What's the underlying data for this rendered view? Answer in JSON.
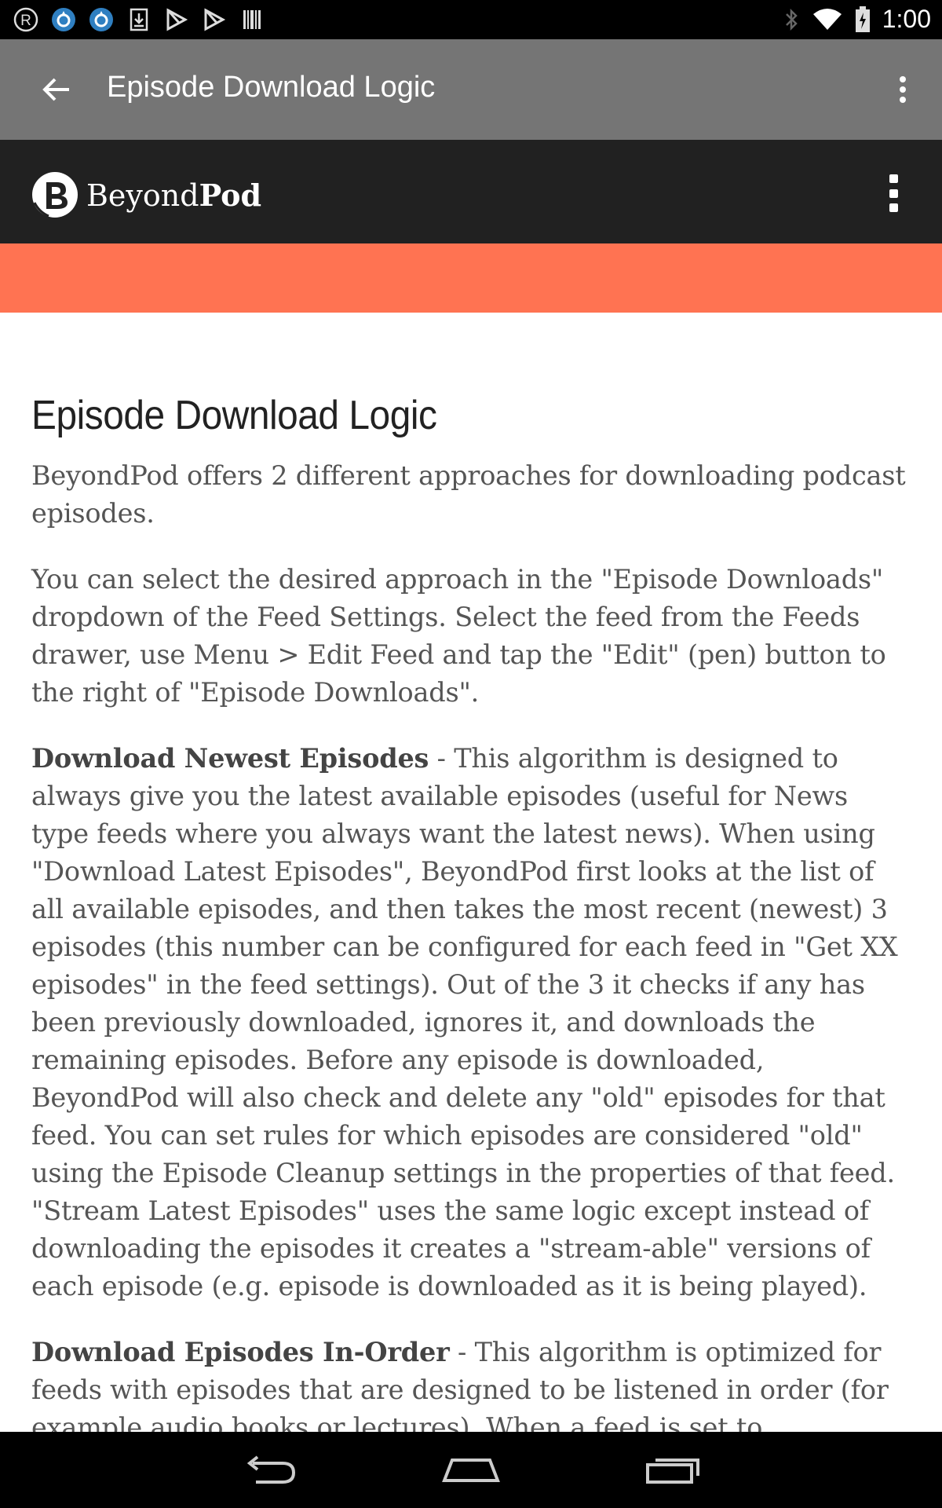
{
  "status_bar": {
    "time": "1:00",
    "left_icons": [
      "registered-icon",
      "app-drop-icon",
      "app-drop-icon",
      "download-icon",
      "play-store-icon",
      "play-store-icon",
      "barcode-icon"
    ],
    "right_icons": [
      "bluetooth-icon",
      "wifi-icon",
      "battery-icon"
    ]
  },
  "toolbar": {
    "title": "Episode Download Logic",
    "back_icon": "arrow-back-icon",
    "overflow_icon": "more-vert-icon"
  },
  "site": {
    "logo_text_light": "Beyond",
    "logo_text_bold": "Pod",
    "menu_icon": "more-vert-icon",
    "band_color": "#ff7352"
  },
  "article": {
    "heading": "Episode Download Logic",
    "p1": "BeyondPod offers 2 different approaches for downloading podcast episodes.",
    "p2": "You can select the desired approach in the \"Episode Downloads\" dropdown of the Feed Settings. Select the feed from the Feeds drawer, use Menu > Edit Feed and tap the \"Edit\" (pen) button to the right of \"Episode Downloads\".",
    "p3_bold": "Download Newest Episodes",
    "p3_text": " - This algorithm is designed to always give you the latest available episodes (useful for News type feeds where you always want the latest news). When using \"Download Latest Episodes\", BeyondPod first looks at the list of all available episodes, and then takes the most recent (newest) 3 episodes (this number can be configured for each feed in \"Get XX episodes\" in the feed settings). Out of the 3 it checks if any has been previously downloaded, ignores it, and downloads the remaining episodes. Before any episode is downloaded, BeyondPod will also check and delete any \"old\" episodes for that feed. You can set rules for which episodes are considered \"old\" using the Episode Cleanup settings in the properties of that feed. \"Stream Latest Episodes\" uses the same logic except instead of downloading the episodes it creates a \"stream-able\" versions of each episode (e.g. episode is downloaded as it is being played).",
    "p4_bold": "Download Episodes In-Order",
    "p4_text": " - This algorithm is optimized for feeds with episodes that are designed to be listened in order (for example audio books or lectures). When a feed is set to"
  },
  "nav_bar": {
    "back": "nav-back-icon",
    "home": "nav-home-icon",
    "recents": "nav-recents-icon"
  }
}
